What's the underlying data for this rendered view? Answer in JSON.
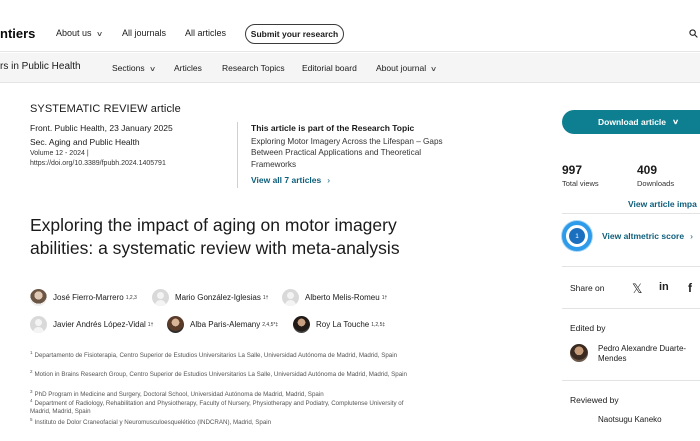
{
  "topbar": {
    "logo": "ntiers",
    "nav": [
      "About us",
      "All journals",
      "All articles"
    ],
    "submit": "Submit your research"
  },
  "subbar": {
    "journal": "rs in Public Health",
    "nav": [
      "Sections",
      "Articles",
      "Research Topics",
      "Editorial board",
      "About journal"
    ]
  },
  "article": {
    "type": "SYSTEMATIC REVIEW article",
    "journal_date": "Front. Public Health, 23 January 2025",
    "section": "Sec. Aging and Public Health",
    "volume": "Volume 12 - 2024 |",
    "doi": "https://doi.org/10.3389/fpubh.2024.1405791",
    "title": "Exploring the impact of aging on motor imagery abilities: a systematic review with meta-analysis"
  },
  "research_topic": {
    "heading": "This article is part of the Research Topic",
    "title": "Exploring Motor Imagery Across the Lifespan – Gaps Between Practical Applications and Theoretical Frameworks",
    "link": "View all 7 articles"
  },
  "authors": [
    {
      "name": "José Fierro-Marrero",
      "sup": "1,2,3"
    },
    {
      "name": "Mario González-Iglesias",
      "sup": "1†"
    },
    {
      "name": "Alberto Melis-Romeu",
      "sup": "1†"
    },
    {
      "name": "Javier Andrés López-Vidal",
      "sup": "1†"
    },
    {
      "name": "Alba Paris-Alemany",
      "sup": "2,4,5*‡"
    },
    {
      "name": "Roy La Touche",
      "sup": "1,2,5‡"
    }
  ],
  "affiliations": [
    {
      "num": "1",
      "text": "Departamento de Fisioterapia, Centro Superior de Estudios Universitarios La Salle, Universidad Autónoma de Madrid, Madrid, Spain"
    },
    {
      "num": "2",
      "text": "Motion in Brains Research Group, Centro Superior de Estudios Universitarios La Salle, Universidad Autónoma de Madrid, Madrid, Spain"
    },
    {
      "num": "3",
      "text": "PhD Program in Medicine and Surgery, Doctoral School, Universidad Autónoma de Madrid, Madrid, Spain"
    },
    {
      "num": "4",
      "text": "Department of Radiology, Rehabilitation and Physiotherapy, Faculty of Nursery, Physiotherapy and Podiatry, Complutense University of Madrid, Madrid, Spain"
    },
    {
      "num": "5",
      "text": "Instituto de Dolor Craneofacial y Neuromusculoesquelético (INDCRAN), Madrid, Spain"
    }
  ],
  "sidebar": {
    "download": "Download article",
    "views": "997",
    "views_label": "Total views",
    "downloads": "409",
    "downloads_label": "Downloads",
    "impact_link": "View article impa",
    "altmetric_score": "1",
    "altmetric_link": "View altmetric score",
    "share_label": "Share on",
    "edited_by": "Edited by",
    "editor": "Pedro Alexandre Duarte-Mendes",
    "reviewed_by": "Reviewed by",
    "reviewer": "Naotsugu Kaneko"
  },
  "icons": [
    "search-icon",
    "chevron-down-icon",
    "chevron-right-icon",
    "x-icon",
    "linkedin-icon",
    "facebook-icon"
  ],
  "colors": {
    "accent": "#0e7f91",
    "link": "#0d5e7a",
    "altmetric": "#2d9bea"
  }
}
